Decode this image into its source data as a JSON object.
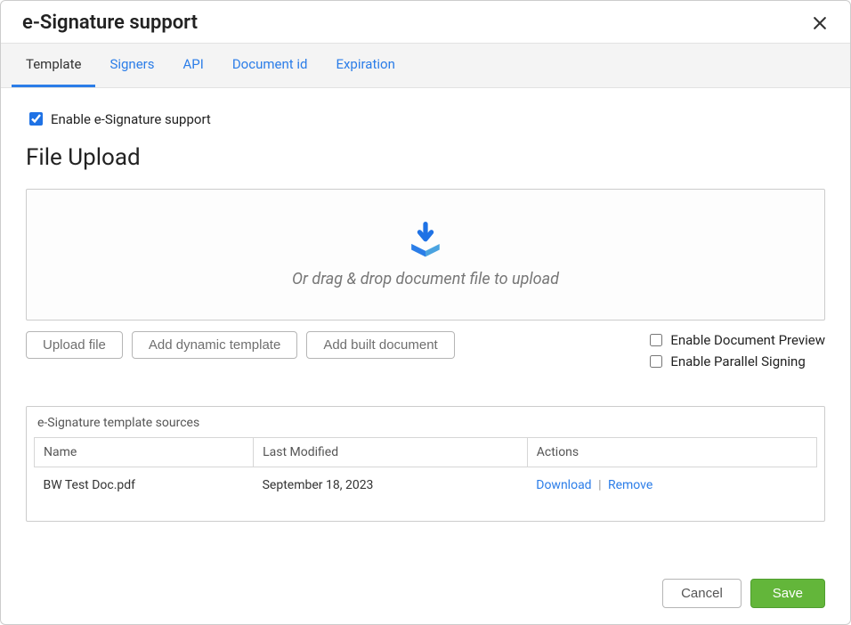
{
  "header": {
    "title": "e-Signature support"
  },
  "tabs": [
    {
      "label": "Template",
      "active": true
    },
    {
      "label": "Signers",
      "active": false
    },
    {
      "label": "API",
      "active": false
    },
    {
      "label": "Document id",
      "active": false
    },
    {
      "label": "Expiration",
      "active": false
    }
  ],
  "enable": {
    "label": "Enable e-Signature support",
    "checked": true
  },
  "upload": {
    "section_title": "File Upload",
    "drop_text": "Or drag & drop document file to upload",
    "buttons": {
      "upload_file": "Upload file",
      "add_dynamic_template": "Add dynamic template",
      "add_built_document": "Add built document"
    }
  },
  "options": {
    "enable_document_preview": {
      "label": "Enable Document Preview",
      "checked": false
    },
    "enable_parallel_signing": {
      "label": "Enable Parallel Signing",
      "checked": false
    }
  },
  "sources": {
    "panel_title": "e-Signature template sources",
    "columns": {
      "name": "Name",
      "last_modified": "Last Modified",
      "actions": "Actions"
    },
    "rows": [
      {
        "name": "BW Test Doc.pdf",
        "last_modified": "September 18, 2023",
        "download_label": "Download",
        "remove_label": "Remove"
      }
    ]
  },
  "footer": {
    "cancel": "Cancel",
    "save": "Save"
  }
}
